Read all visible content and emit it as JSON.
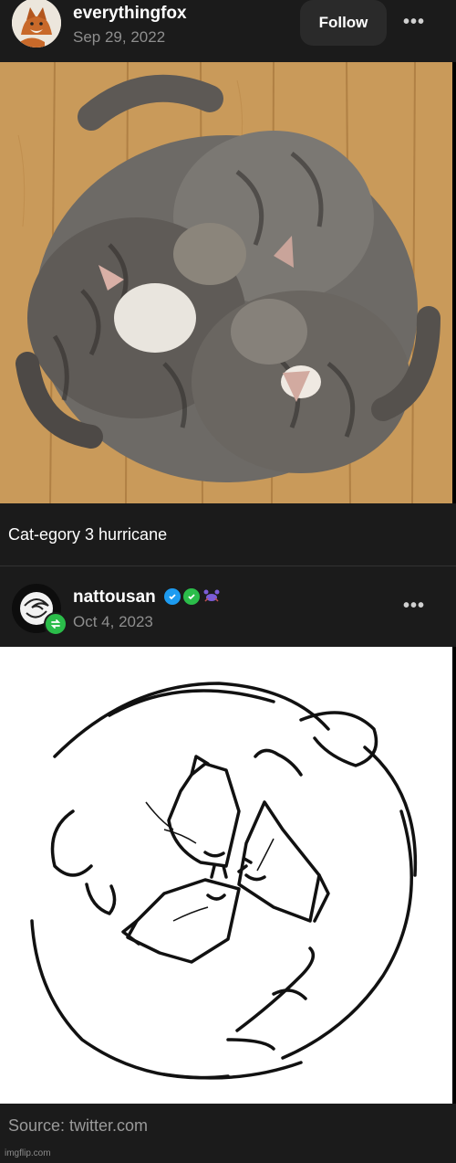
{
  "post": {
    "username": "everythingfox",
    "date": "Sep 29, 2022",
    "follow_label": "Follow",
    "more_label": "•••",
    "caption": "Cat-egory 3 hurricane"
  },
  "reblog": {
    "username": "nattousan",
    "date": "Oct 4, 2023",
    "more_label": "•••",
    "badges": [
      "verified-check-icon",
      "green-check-icon",
      "crab-icon"
    ]
  },
  "source": {
    "label": "Source: twitter.com"
  },
  "watermark": {
    "label": "imgflip.com"
  },
  "colors": {
    "background": "#1b1b1b",
    "text": "#ffffff",
    "muted": "#8e8e8e",
    "verified_blue": "#1d9bf0",
    "green": "#2bbd4a"
  }
}
